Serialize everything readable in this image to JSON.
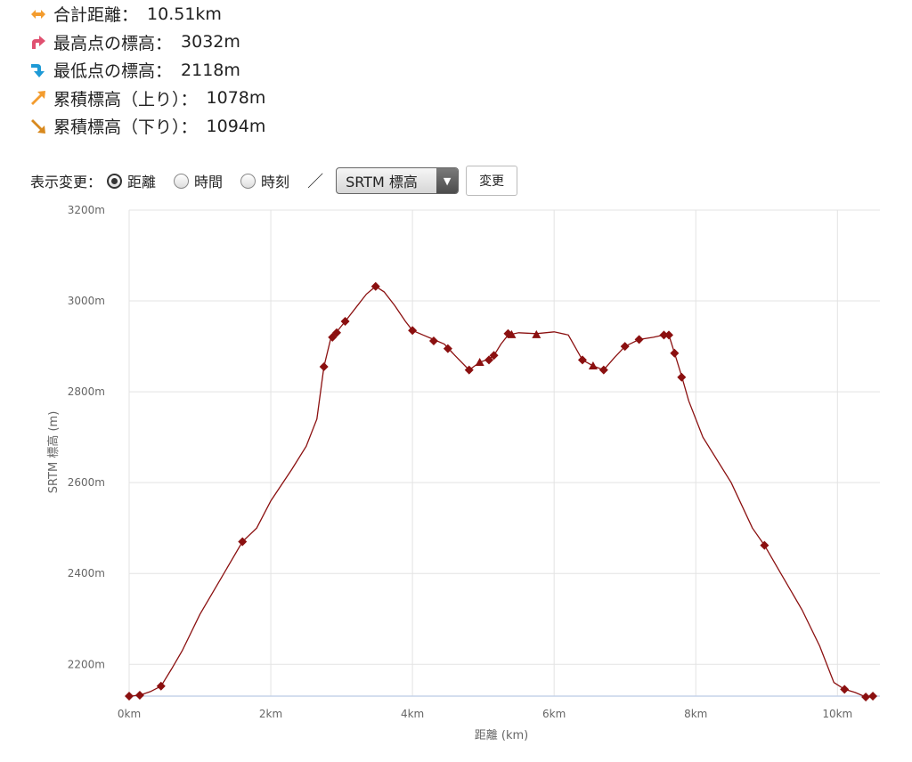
{
  "stats": [
    {
      "icon": "horizontal-double-arrow-icon",
      "color": "#f39c2e",
      "label": "合計距離：",
      "value": "10.51km"
    },
    {
      "icon": "up-turn-arrow-icon",
      "color": "#e05070",
      "label": "最高点の標高：",
      "value": "3032m"
    },
    {
      "icon": "down-turn-arrow-icon",
      "color": "#1e9ad6",
      "label": "最低点の標高：",
      "value": "2118m"
    },
    {
      "icon": "up-right-arrow-icon",
      "color": "#f39c2e",
      "label": "累積標高（上り）：",
      "value": "1078m"
    },
    {
      "icon": "down-right-arrow-icon",
      "color": "#d8891e",
      "label": "累積標高（下り）：",
      "value": "1094m"
    }
  ],
  "controls": {
    "label": "表示変更：",
    "radios": [
      {
        "label": "距離",
        "checked": true
      },
      {
        "label": "時間",
        "checked": false
      },
      {
        "label": "時刻",
        "checked": false
      }
    ],
    "separator": "／",
    "select_value": "SRTM 標高",
    "button_label": "変更"
  },
  "chart_data": {
    "type": "line",
    "xlabel": "距離 (km)",
    "ylabel": "SRTM 標高 (m)",
    "xlim": [
      0,
      10.6
    ],
    "ylim": [
      2130,
      3200
    ],
    "x_ticks": [
      0,
      2,
      4,
      6,
      8,
      10
    ],
    "x_tick_labels": [
      "0km",
      "2km",
      "4km",
      "6km",
      "8km",
      "10km"
    ],
    "y_ticks": [
      2200,
      2400,
      2600,
      2800,
      3000,
      3200
    ],
    "y_tick_labels": [
      "2200m",
      "2400m",
      "2600m",
      "2800m",
      "3000m",
      "3200m"
    ],
    "line_color": "#8b1010",
    "series": [
      {
        "values": [
          [
            0.0,
            2130
          ],
          [
            0.15,
            2132
          ],
          [
            0.3,
            2140
          ],
          [
            0.45,
            2152
          ],
          [
            0.6,
            2190
          ],
          [
            0.75,
            2230
          ],
          [
            1.0,
            2310
          ],
          [
            1.3,
            2390
          ],
          [
            1.6,
            2470
          ],
          [
            1.8,
            2500
          ],
          [
            2.0,
            2560
          ],
          [
            2.3,
            2630
          ],
          [
            2.5,
            2680
          ],
          [
            2.65,
            2740
          ],
          [
            2.75,
            2855
          ],
          [
            2.85,
            2920
          ],
          [
            2.92,
            2930
          ],
          [
            3.05,
            2955
          ],
          [
            3.2,
            2985
          ],
          [
            3.35,
            3015
          ],
          [
            3.48,
            3032
          ],
          [
            3.6,
            3020
          ],
          [
            3.75,
            2990
          ],
          [
            3.9,
            2955
          ],
          [
            4.0,
            2935
          ],
          [
            4.15,
            2925
          ],
          [
            4.3,
            2915
          ],
          [
            4.45,
            2905
          ],
          [
            4.6,
            2880
          ],
          [
            4.8,
            2848
          ],
          [
            4.95,
            2865
          ],
          [
            5.08,
            2872
          ],
          [
            5.15,
            2880
          ],
          [
            5.25,
            2905
          ],
          [
            5.35,
            2925
          ],
          [
            5.5,
            2930
          ],
          [
            5.75,
            2928
          ],
          [
            6.0,
            2932
          ],
          [
            6.2,
            2925
          ],
          [
            6.4,
            2870
          ],
          [
            6.55,
            2857
          ],
          [
            6.7,
            2848
          ],
          [
            6.85,
            2875
          ],
          [
            7.0,
            2900
          ],
          [
            7.2,
            2915
          ],
          [
            7.4,
            2920
          ],
          [
            7.55,
            2925
          ],
          [
            7.62,
            2925
          ],
          [
            7.7,
            2885
          ],
          [
            7.8,
            2835
          ],
          [
            7.9,
            2780
          ],
          [
            8.1,
            2700
          ],
          [
            8.5,
            2600
          ],
          [
            8.8,
            2500
          ],
          [
            8.97,
            2462
          ],
          [
            9.2,
            2400
          ],
          [
            9.5,
            2320
          ],
          [
            9.75,
            2240
          ],
          [
            9.95,
            2160
          ],
          [
            10.1,
            2145
          ],
          [
            10.25,
            2138
          ],
          [
            10.4,
            2128
          ],
          [
            10.5,
            2130
          ]
        ]
      }
    ],
    "markers": [
      {
        "x": 0.0,
        "y": 2130,
        "shape": "diamond"
      },
      {
        "x": 0.15,
        "y": 2132,
        "shape": "diamond"
      },
      {
        "x": 0.45,
        "y": 2152,
        "shape": "diamond"
      },
      {
        "x": 1.6,
        "y": 2470,
        "shape": "diamond"
      },
      {
        "x": 2.75,
        "y": 2855,
        "shape": "diamond"
      },
      {
        "x": 2.87,
        "y": 2920,
        "shape": "diamond"
      },
      {
        "x": 2.93,
        "y": 2930,
        "shape": "diamond"
      },
      {
        "x": 3.05,
        "y": 2955,
        "shape": "diamond"
      },
      {
        "x": 3.48,
        "y": 3032,
        "shape": "diamond"
      },
      {
        "x": 4.0,
        "y": 2935,
        "shape": "diamond"
      },
      {
        "x": 4.3,
        "y": 2912,
        "shape": "diamond"
      },
      {
        "x": 4.5,
        "y": 2895,
        "shape": "diamond"
      },
      {
        "x": 4.8,
        "y": 2848,
        "shape": "diamond"
      },
      {
        "x": 4.95,
        "y": 2865,
        "shape": "triangle"
      },
      {
        "x": 5.08,
        "y": 2870,
        "shape": "diamond"
      },
      {
        "x": 5.15,
        "y": 2880,
        "shape": "diamond"
      },
      {
        "x": 5.35,
        "y": 2928,
        "shape": "diamond"
      },
      {
        "x": 5.4,
        "y": 2926,
        "shape": "triangle"
      },
      {
        "x": 5.75,
        "y": 2926,
        "shape": "triangle"
      },
      {
        "x": 6.4,
        "y": 2870,
        "shape": "diamond"
      },
      {
        "x": 6.55,
        "y": 2857,
        "shape": "triangle"
      },
      {
        "x": 6.7,
        "y": 2848,
        "shape": "diamond"
      },
      {
        "x": 7.0,
        "y": 2900,
        "shape": "diamond"
      },
      {
        "x": 7.2,
        "y": 2915,
        "shape": "diamond"
      },
      {
        "x": 7.55,
        "y": 2925,
        "shape": "diamond"
      },
      {
        "x": 7.62,
        "y": 2925,
        "shape": "diamond"
      },
      {
        "x": 7.7,
        "y": 2885,
        "shape": "diamond"
      },
      {
        "x": 7.8,
        "y": 2832,
        "shape": "diamond"
      },
      {
        "x": 8.97,
        "y": 2462,
        "shape": "diamond"
      },
      {
        "x": 10.1,
        "y": 2145,
        "shape": "diamond"
      },
      {
        "x": 10.4,
        "y": 2128,
        "shape": "diamond"
      },
      {
        "x": 10.5,
        "y": 2130,
        "shape": "diamond"
      }
    ],
    "grid": true,
    "legend": "none"
  }
}
